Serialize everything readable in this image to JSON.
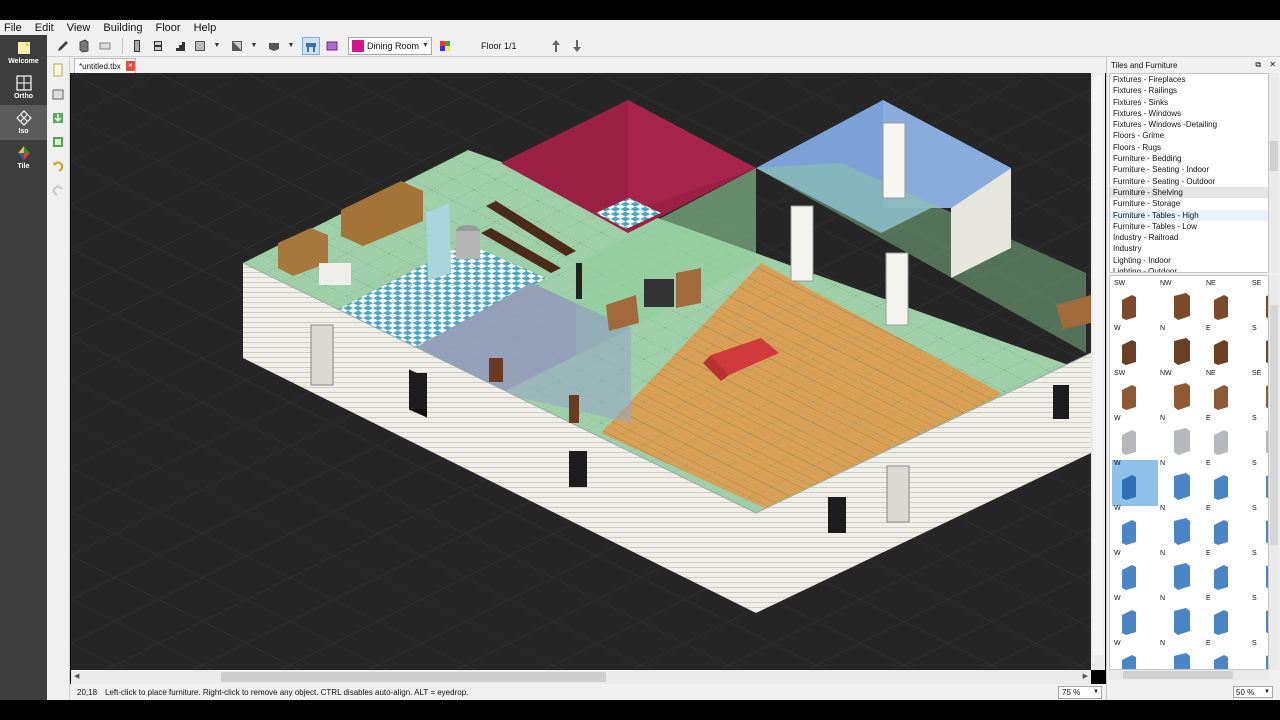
{
  "menubar": {
    "items": [
      "File",
      "Edit",
      "View",
      "Building",
      "Floor",
      "Help"
    ]
  },
  "toolbar": {
    "room": {
      "label": "Dining Room",
      "swatch_color": "#d6158a"
    },
    "floor_label": "Floor 1/1",
    "icons": [
      "pencil-icon",
      "wall-icon",
      "eraser-icon",
      "door-icon",
      "window-icon",
      "stairs-icon",
      "roof-icon",
      "roof-corner-icon",
      "furniture-icon",
      "select-move-icon",
      "room-tool-icon",
      "floor-up-icon",
      "floor-down-icon"
    ]
  },
  "modes": [
    {
      "label": "Welcome",
      "icon": "welcome-icon"
    },
    {
      "label": "Ortho",
      "icon": "ortho-grid-icon"
    },
    {
      "label": "Iso",
      "icon": "iso-icon",
      "active": true
    },
    {
      "label": "Tile",
      "icon": "tile-icon"
    }
  ],
  "document": {
    "tab_label": "*untitled.tbx"
  },
  "status": {
    "coords": "20,18",
    "hint": "Left-click to place furniture. Right-click to remove any object. CTRL disables auto-align. ALT = eyedrop.",
    "zoom": "75 %"
  },
  "dock": {
    "title": "Tiles and Furniture",
    "categories": [
      "Fixtures - Fireplaces",
      "Fixtures - Railings",
      "Fixtures - Sinks",
      "Fixtures - Windows",
      "Fixtures - Windows -Detailing",
      "Floors - Grime",
      "Floors - Rugs",
      "Furniture - Bedding",
      "Furniture - Seating - Indoor",
      "Furniture - Seating - Outdoor",
      "Furniture - Shelving",
      "Furniture - Storage",
      "Furniture - Tables - High",
      "Furniture - Tables - Low",
      "Industry - Railroad",
      "Industry",
      "Lighting - Indoor",
      "Lighting - Outdoor"
    ],
    "selected_category": "Furniture - Shelving",
    "hover_category": "Furniture - Tables - High",
    "tile_rows": [
      [
        "SW",
        "NW",
        "NE",
        "SE"
      ],
      [
        "W",
        "N",
        "E",
        "S"
      ],
      [
        "SW",
        "NW",
        "NE",
        "SE"
      ],
      [
        "W",
        "N",
        "E",
        "S"
      ],
      [
        "W",
        "N",
        "E",
        "S"
      ],
      [
        "W",
        "N",
        "E",
        "S"
      ],
      [
        "W",
        "N",
        "E",
        "S"
      ],
      [
        "W",
        "N",
        "E",
        "S"
      ],
      [
        "W",
        "N",
        "E",
        "S"
      ]
    ],
    "zoom": "50 %"
  }
}
